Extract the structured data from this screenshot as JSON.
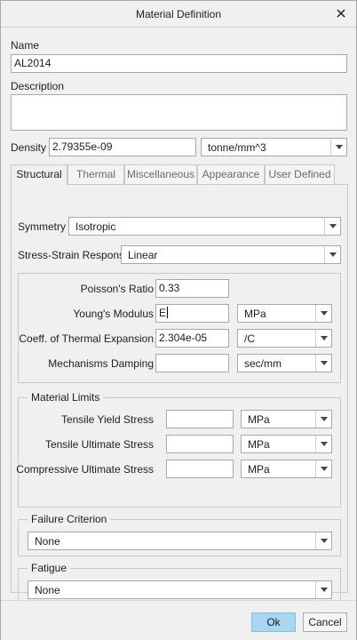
{
  "window": {
    "title": "Material Definition"
  },
  "name": {
    "label": "Name",
    "value": "AL2014"
  },
  "description": {
    "label": "Description",
    "value": ""
  },
  "density": {
    "label": "Density",
    "value": "2.79355e-09",
    "unit": "tonne/mm^3"
  },
  "tabs": [
    {
      "label": "Structural"
    },
    {
      "label": "Thermal"
    },
    {
      "label": "Miscellaneous"
    },
    {
      "label": "Appearance"
    },
    {
      "label": "User Defined"
    }
  ],
  "structural": {
    "symmetry": {
      "label": "Symmetry",
      "value": "Isotropic"
    },
    "stress_strain": {
      "label": "Stress-Strain Response",
      "value": "Linear"
    },
    "properties": [
      {
        "label": "Poisson's Ratio",
        "value": "0.33",
        "unit": ""
      },
      {
        "label": "Young's Modulus",
        "value": "E",
        "unit": "MPa"
      },
      {
        "label": "Coeff. of Thermal Expansion",
        "value": "2.304e-05",
        "unit": "/C"
      },
      {
        "label": "Mechanisms Damping",
        "value": "",
        "unit": "sec/mm"
      }
    ],
    "limits": {
      "title": "Material Limits",
      "rows": [
        {
          "label": "Tensile Yield Stress",
          "value": "",
          "unit": "MPa"
        },
        {
          "label": "Tensile Ultimate Stress",
          "value": "",
          "unit": "MPa"
        },
        {
          "label": "Compressive Ultimate Stress",
          "value": "",
          "unit": "MPa"
        }
      ]
    },
    "failure": {
      "title": "Failure Criterion",
      "value": "None"
    },
    "fatigue": {
      "title": "Fatigue",
      "value": "None"
    }
  },
  "buttons": {
    "ok": "Ok",
    "cancel": "Cancel"
  },
  "colors": {
    "ok_button": "#a8d5f2",
    "background": "#f0f0f0"
  }
}
